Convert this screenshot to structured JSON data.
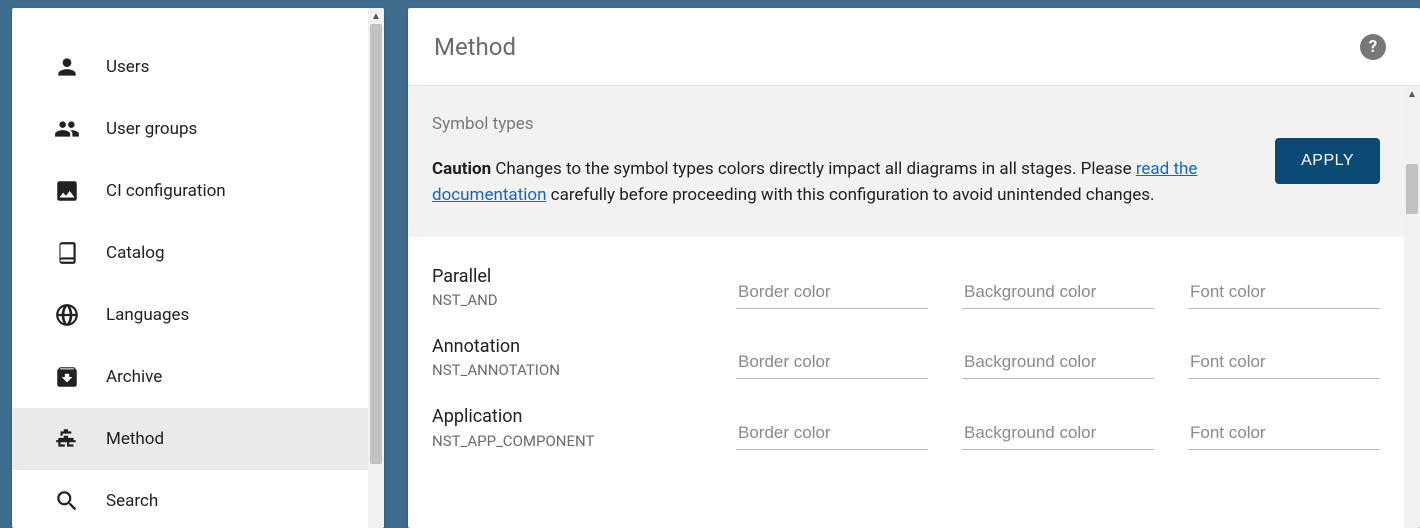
{
  "sidebar": {
    "items": [
      {
        "label": "Users",
        "icon": "user-icon",
        "active": false
      },
      {
        "label": "User groups",
        "icon": "group-icon",
        "active": false
      },
      {
        "label": " CI configuration",
        "icon": "image-icon",
        "active": false
      },
      {
        "label": "Catalog",
        "icon": "book-icon",
        "active": false
      },
      {
        "label": "Languages",
        "icon": "globe-icon",
        "active": false
      },
      {
        "label": "Archive",
        "icon": "archive-icon",
        "active": false
      },
      {
        "label": "Method",
        "icon": "sitemap-icon",
        "active": true
      },
      {
        "label": "Search",
        "icon": "search-icon",
        "active": false
      }
    ]
  },
  "main": {
    "title": "Method",
    "help_tooltip": "Help",
    "caution": {
      "heading": "Symbol types",
      "strong": "Caution",
      "text_before_link": " Changes to the symbol types colors directly impact all diagrams in all stages. Please ",
      "link_text": "read the documentation",
      "text_after_link": " carefully before proceeding with this configuration to avoid unintended changes.",
      "apply_label": "APPLY"
    },
    "color_placeholders": {
      "border": "Border color",
      "background": "Background color",
      "font": "Font color"
    },
    "symbols": [
      {
        "name": "Parallel",
        "id": "NST_AND"
      },
      {
        "name": "Annotation",
        "id": "NST_ANNOTATION"
      },
      {
        "name": "Application",
        "id": "NST_APP_COMPONENT"
      }
    ]
  }
}
